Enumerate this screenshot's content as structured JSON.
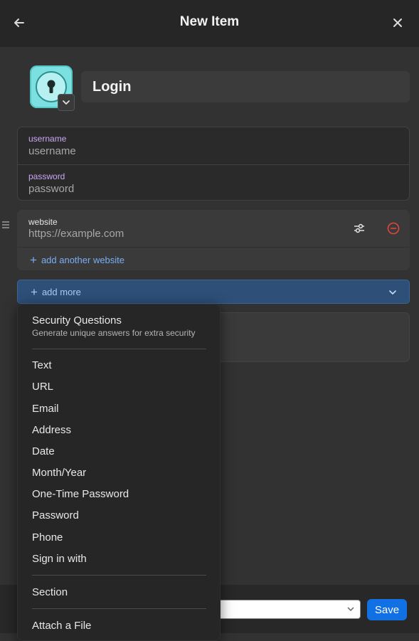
{
  "header": {
    "title": "New Item",
    "back_icon": "arrow-left-icon",
    "close_icon": "close-icon"
  },
  "item": {
    "title": "Login",
    "icon": "keyhole-lock-icon",
    "fields": [
      {
        "label": "username",
        "placeholder": "username"
      },
      {
        "label": "password",
        "placeholder": "password"
      }
    ]
  },
  "website": {
    "label": "website",
    "placeholder": "https://example.com",
    "add_another": "add another website"
  },
  "add_more": {
    "label": "add more"
  },
  "menu": {
    "security": {
      "title": "Security Questions",
      "subtitle": "Generate unique answers for extra security"
    },
    "items": [
      "Text",
      "URL",
      "Email",
      "Address",
      "Date",
      "Month/Year",
      "One-Time Password",
      "Password",
      "Phone",
      "Sign in with"
    ],
    "section": "Section",
    "attach": "Attach a File"
  },
  "footer": {
    "vault_value": "",
    "save_label": "Save"
  },
  "colors": {
    "accent": "#1270e5",
    "field_label": "#c9a7f5",
    "link": "#7aaef5",
    "remove": "#e0473a",
    "icon_teal": "#7de0e0"
  }
}
